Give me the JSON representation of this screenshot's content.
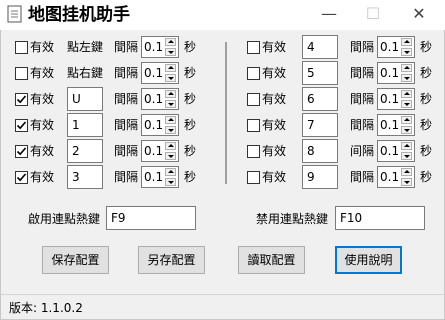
{
  "window": {
    "title": "地图挂机助手",
    "minimize": "—",
    "maximize": "☐",
    "close": "✕"
  },
  "labels": {
    "enabled": "有效",
    "interval": "間隔",
    "interval_alt": "间隔",
    "seconds": "秒"
  },
  "left_rows": [
    {
      "checked": false,
      "key": "點左鍵",
      "interval": "0.1"
    },
    {
      "checked": false,
      "key": "點右鍵",
      "interval": "0.1"
    },
    {
      "checked": true,
      "key": "U",
      "interval": "0.1"
    },
    {
      "checked": true,
      "key": "1",
      "interval": "0.1"
    },
    {
      "checked": true,
      "key": "2",
      "interval": "0.1"
    },
    {
      "checked": true,
      "key": "3",
      "interval": "0.1"
    }
  ],
  "right_rows": [
    {
      "checked": false,
      "key": "4",
      "interval": "0.1"
    },
    {
      "checked": false,
      "key": "5",
      "interval": "0.1"
    },
    {
      "checked": false,
      "key": "6",
      "interval": "0.1"
    },
    {
      "checked": false,
      "key": "7",
      "interval": "0.1"
    },
    {
      "checked": false,
      "key": "8",
      "interval": "0.1"
    },
    {
      "checked": false,
      "key": "9",
      "interval": "0.1"
    }
  ],
  "hotkeys": {
    "enable_label": "啟用連點熱鍵",
    "enable_value": "F9",
    "disable_label": "禁用連點熱鍵",
    "disable_value": "F10"
  },
  "buttons": {
    "save": "保存配置",
    "save_as": "另存配置",
    "load": "讀取配置",
    "help": "使用說明"
  },
  "status": {
    "version": "版本: 1.1.0.2"
  },
  "colors": {
    "focus_border": "#0078d7",
    "window_bg": "#f0f0f0"
  }
}
